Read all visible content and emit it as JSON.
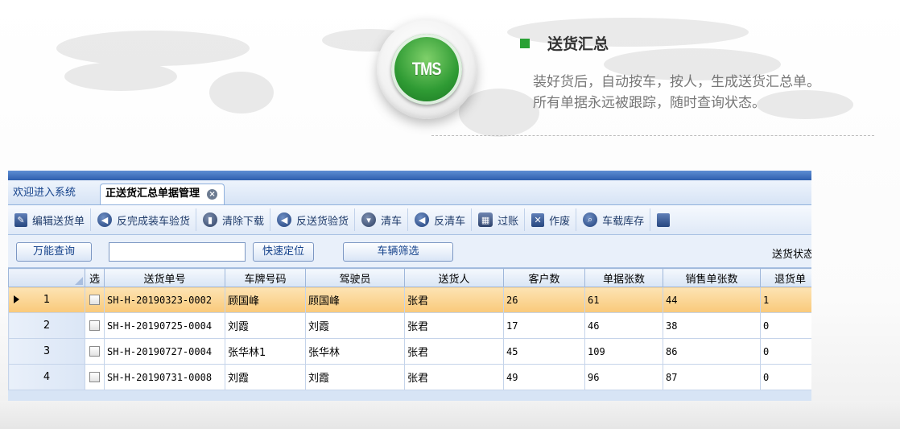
{
  "badge": {
    "text": "TMS"
  },
  "feature": {
    "title": "送货汇总",
    "line1": "装好货后，自动按车，按人，生成送货汇总单。",
    "line2": "所有单据永远被跟踪，随时查询状态。"
  },
  "tabs": [
    {
      "label": "欢迎进入系统"
    },
    {
      "label": "正送货汇总单据管理"
    }
  ],
  "toolbar": [
    {
      "label": "编辑送货单",
      "icon": "edit-doc-icon"
    },
    {
      "label": "反完成装车验货",
      "icon": "arrow-left-icon"
    },
    {
      "label": "清除下载",
      "icon": "trash-icon"
    },
    {
      "label": "反送货验货",
      "icon": "arrow-left-icon"
    },
    {
      "label": "清车",
      "icon": "cart-icon"
    },
    {
      "label": "反清车",
      "icon": "arrow-left-icon"
    },
    {
      "label": "过账",
      "icon": "calculator-icon"
    },
    {
      "label": "作废",
      "icon": "void-doc-icon"
    },
    {
      "label": "车载库存",
      "icon": "search-icon"
    }
  ],
  "filter": {
    "universal_query": "万能查询",
    "search_value": "",
    "quick_locate": "快速定位",
    "vehicle_filter": "车辆筛选",
    "status_label": "送货状态"
  },
  "grid": {
    "headers": [
      "选",
      "送货单号",
      "车牌号码",
      "驾驶员",
      "送货人",
      "客户数",
      "单据张数",
      "销售单张数",
      "退货单"
    ],
    "rows": [
      {
        "no": "1",
        "order": "SH-H-20190323-0002",
        "plate": "顾国峰",
        "driver": "顾国峰",
        "deliverer": "张君",
        "customers": "26",
        "docs": "61",
        "sales_docs": "44",
        "returns": "1",
        "selected": true
      },
      {
        "no": "2",
        "order": "SH-H-20190725-0004",
        "plate": "刘霞",
        "driver": "刘霞",
        "deliverer": "张君",
        "customers": "17",
        "docs": "46",
        "sales_docs": "38",
        "returns": "0",
        "selected": false
      },
      {
        "no": "3",
        "order": "SH-H-20190727-0004",
        "plate": "张华林1",
        "driver": "张华林",
        "deliverer": "张君",
        "customers": "45",
        "docs": "109",
        "sales_docs": "86",
        "returns": "0",
        "selected": false
      },
      {
        "no": "4",
        "order": "SH-H-20190731-0008",
        "plate": "刘霞",
        "driver": "刘霞",
        "deliverer": "张君",
        "customers": "49",
        "docs": "96",
        "sales_docs": "87",
        "returns": "0",
        "selected": false
      }
    ]
  },
  "colors": {
    "accent_green": "#2aa135",
    "selected_row": "#f9c97a",
    "toolbar_blue": "#1f3b6a"
  }
}
